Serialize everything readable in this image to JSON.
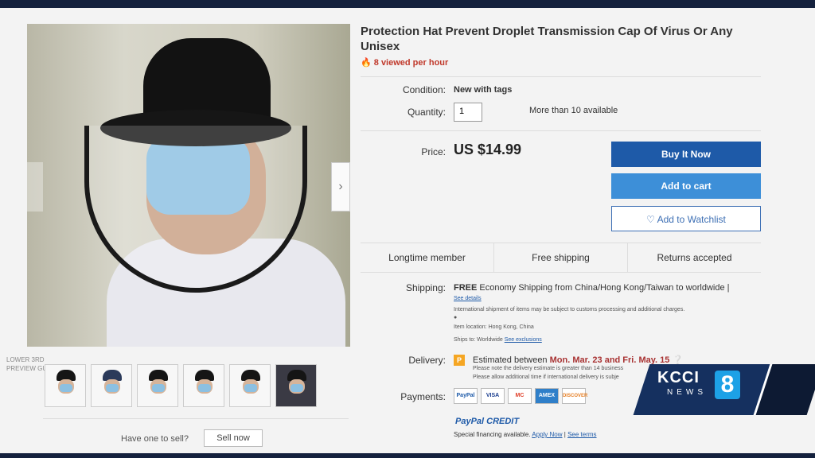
{
  "title": "Protection Hat Prevent Droplet Transmission Cap Of Virus Or Any Unisex",
  "viewed": "8 viewed per hour",
  "condition": {
    "label": "Condition:",
    "value": "New with tags"
  },
  "quantity": {
    "label": "Quantity:",
    "value": "1",
    "available": "More than 10 available"
  },
  "price": {
    "label": "Price:",
    "value": "US $14.99"
  },
  "buttons": {
    "buy": "Buy It Now",
    "cart": "Add to cart",
    "watch": "Add to Watchlist"
  },
  "badges": [
    "Longtime member",
    "Free shipping",
    "Returns accepted"
  ],
  "shipping": {
    "label": "Shipping:",
    "free": "FREE",
    "text": "Economy Shipping from China/Hong Kong/Taiwan to worldwide |",
    "see_details": "See details",
    "note": "International shipment of items may be subject to customs processing and additional charges.",
    "location": "Item location:  Hong Kong, China",
    "ships_to": "Ships to:  Worldwide",
    "exclusions": "See exclusions"
  },
  "delivery": {
    "label": "Delivery:",
    "icon_letter": "P",
    "text": "Estimated between",
    "dates": "Mon. Mar. 23 and Fri. May. 15",
    "note1": "Please note the delivery estimate is greater than 14 business",
    "note2": "Please allow additional time if international delivery is subje"
  },
  "payments": {
    "label": "Payments:",
    "methods": [
      "PayPal",
      "VISA",
      "MC",
      "AMEX",
      "DISCOVER"
    ],
    "paypal_credit": "PayPal CREDIT",
    "special": "Special financing available.",
    "apply": "Apply Now",
    "terms": "See terms"
  },
  "lower_third": [
    "LOWER 3RD",
    "PREVIEW GUIDE"
  ],
  "footer": {
    "have_one": "Have one to sell?",
    "sell": "Sell now"
  },
  "logo": {
    "name": "KCCI",
    "sub": "NEWS",
    "number": "8"
  },
  "colors": {
    "buy": "#1e5aa8",
    "cart": "#3d8fd8",
    "viewed": "#c0392b",
    "logo": "#15305f"
  }
}
